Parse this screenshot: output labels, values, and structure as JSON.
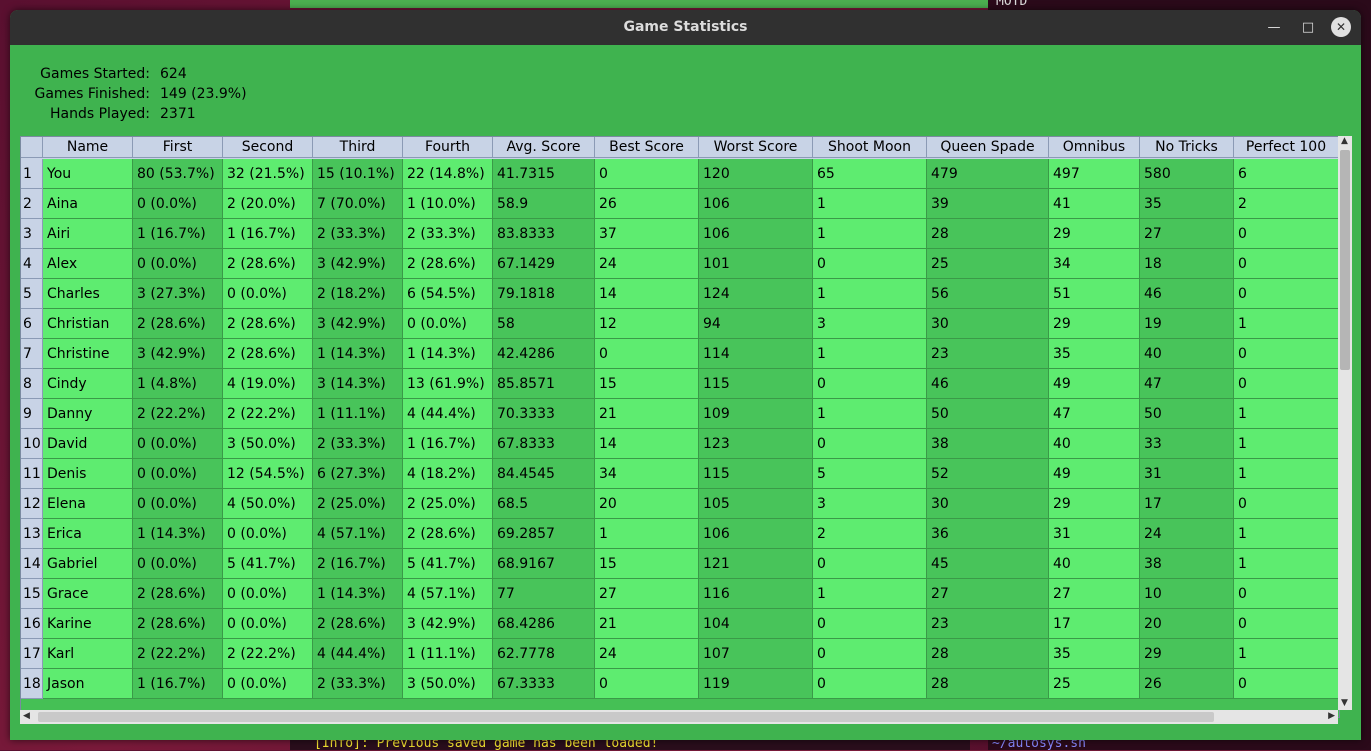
{
  "window": {
    "title": "Game Statistics"
  },
  "background": {
    "motd": "MOTD",
    "info_line": "[Info]: Previous saved game has been loaded!",
    "prompt_line": "~/autosys.sh"
  },
  "stats": {
    "games_started_label": "Games Started:",
    "games_started": "624",
    "games_finished_label": "Games Finished:",
    "games_finished": "149 (23.9%)",
    "hands_played_label": "Hands Played:",
    "hands_played": "2371"
  },
  "table": {
    "columns": [
      "Name",
      "First",
      "Second",
      "Third",
      "Fourth",
      "Avg. Score",
      "Best Score",
      "Worst Score",
      "Shoot Moon",
      "Queen Spade",
      "Omnibus",
      "No Tricks",
      "Perfect 100"
    ],
    "rows": [
      [
        "1",
        "You",
        "80 (53.7%)",
        "32 (21.5%)",
        "15 (10.1%)",
        "22 (14.8%)",
        "41.7315",
        "0",
        "120",
        "65",
        "479",
        "497",
        "580",
        "6"
      ],
      [
        "2",
        "Aina",
        "0 (0.0%)",
        "2 (20.0%)",
        "7 (70.0%)",
        "1 (10.0%)",
        "58.9",
        "26",
        "106",
        "1",
        "39",
        "41",
        "35",
        "2"
      ],
      [
        "3",
        "Airi",
        "1 (16.7%)",
        "1 (16.7%)",
        "2 (33.3%)",
        "2 (33.3%)",
        "83.8333",
        "37",
        "106",
        "1",
        "28",
        "29",
        "27",
        "0"
      ],
      [
        "4",
        "Alex",
        "0 (0.0%)",
        "2 (28.6%)",
        "3 (42.9%)",
        "2 (28.6%)",
        "67.1429",
        "24",
        "101",
        "0",
        "25",
        "34",
        "18",
        "0"
      ],
      [
        "5",
        "Charles",
        "3 (27.3%)",
        "0 (0.0%)",
        "2 (18.2%)",
        "6 (54.5%)",
        "79.1818",
        "14",
        "124",
        "1",
        "56",
        "51",
        "46",
        "0"
      ],
      [
        "6",
        "Christian",
        "2 (28.6%)",
        "2 (28.6%)",
        "3 (42.9%)",
        "0 (0.0%)",
        "58",
        "12",
        "94",
        "3",
        "30",
        "29",
        "19",
        "1"
      ],
      [
        "7",
        "Christine",
        "3 (42.9%)",
        "2 (28.6%)",
        "1 (14.3%)",
        "1 (14.3%)",
        "42.4286",
        "0",
        "114",
        "1",
        "23",
        "35",
        "40",
        "0"
      ],
      [
        "8",
        "Cindy",
        "1 (4.8%)",
        "4 (19.0%)",
        "3 (14.3%)",
        "13 (61.9%)",
        "85.8571",
        "15",
        "115",
        "0",
        "46",
        "49",
        "47",
        "0"
      ],
      [
        "9",
        "Danny",
        "2 (22.2%)",
        "2 (22.2%)",
        "1 (11.1%)",
        "4 (44.4%)",
        "70.3333",
        "21",
        "109",
        "1",
        "50",
        "47",
        "50",
        "1"
      ],
      [
        "10",
        "David",
        "0 (0.0%)",
        "3 (50.0%)",
        "2 (33.3%)",
        "1 (16.7%)",
        "67.8333",
        "14",
        "123",
        "0",
        "38",
        "40",
        "33",
        "1"
      ],
      [
        "11",
        "Denis",
        "0 (0.0%)",
        "12 (54.5%)",
        "6 (27.3%)",
        "4 (18.2%)",
        "84.4545",
        "34",
        "115",
        "5",
        "52",
        "49",
        "31",
        "1"
      ],
      [
        "12",
        "Elena",
        "0 (0.0%)",
        "4 (50.0%)",
        "2 (25.0%)",
        "2 (25.0%)",
        "68.5",
        "20",
        "105",
        "3",
        "30",
        "29",
        "17",
        "0"
      ],
      [
        "13",
        "Erica",
        "1 (14.3%)",
        "0 (0.0%)",
        "4 (57.1%)",
        "2 (28.6%)",
        "69.2857",
        "1",
        "106",
        "2",
        "36",
        "31",
        "24",
        "1"
      ],
      [
        "14",
        "Gabriel",
        "0 (0.0%)",
        "5 (41.7%)",
        "2 (16.7%)",
        "5 (41.7%)",
        "68.9167",
        "15",
        "121",
        "0",
        "45",
        "40",
        "38",
        "1"
      ],
      [
        "15",
        "Grace",
        "2 (28.6%)",
        "0 (0.0%)",
        "1 (14.3%)",
        "4 (57.1%)",
        "77",
        "27",
        "116",
        "1",
        "27",
        "27",
        "10",
        "0"
      ],
      [
        "16",
        "Karine",
        "2 (28.6%)",
        "0 (0.0%)",
        "2 (28.6%)",
        "3 (42.9%)",
        "68.4286",
        "21",
        "104",
        "0",
        "23",
        "17",
        "20",
        "0"
      ],
      [
        "17",
        "Karl",
        "2 (22.2%)",
        "2 (22.2%)",
        "4 (44.4%)",
        "1 (11.1%)",
        "62.7778",
        "24",
        "107",
        "0",
        "28",
        "35",
        "29",
        "1"
      ],
      [
        "18",
        "Jason",
        "1 (16.7%)",
        "0 (0.0%)",
        "2 (33.3%)",
        "3 (50.0%)",
        "67.3333",
        "0",
        "119",
        "0",
        "28",
        "25",
        "26",
        "0"
      ]
    ]
  },
  "icons": {
    "minimize": "minimize-icon",
    "maximize": "maximize-icon",
    "close": "close-icon"
  }
}
